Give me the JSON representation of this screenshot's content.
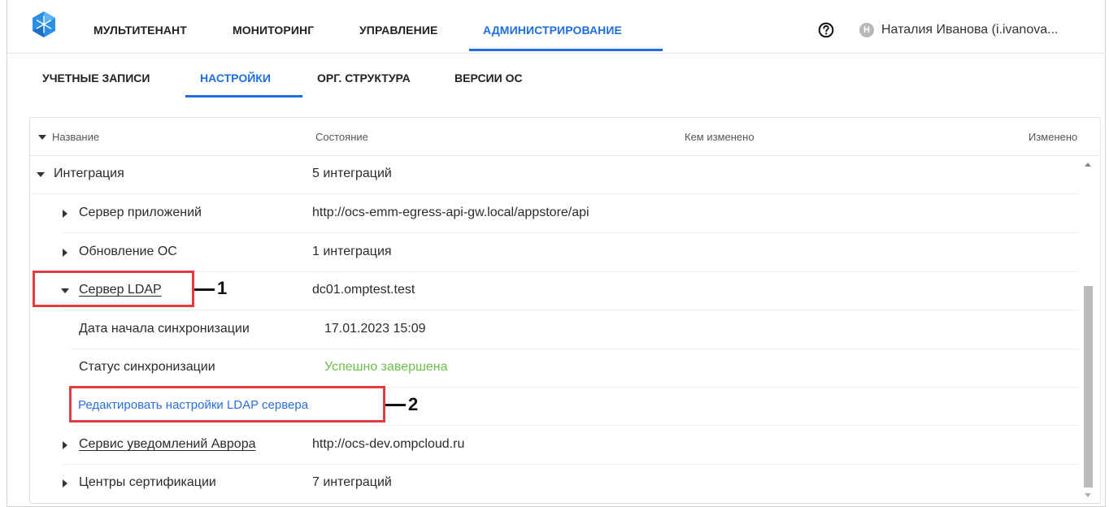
{
  "nav": {
    "items": [
      "МУЛЬТИТЕНАНТ",
      "МОНИТОРИНГ",
      "УПРАВЛЕНИЕ",
      "АДМИНИСТРИРОВАНИЕ"
    ],
    "active_index": 3,
    "help_icon": "question-circle-icon",
    "user_initial": "Н",
    "user_name": "Наталия Иванова (i.ivanova..."
  },
  "subtabs": {
    "items": [
      "УЧЕТНЫЕ ЗАПИСИ",
      "НАСТРОЙКИ",
      "ОРГ. СТРУКТУРА",
      "ВЕРСИИ ОС"
    ],
    "active_index": 1
  },
  "table": {
    "columns": [
      "Название",
      "Состояние",
      "Кем изменено",
      "Изменено"
    ],
    "rows": {
      "integration": {
        "name": "Интеграция",
        "state": "5 интеграций"
      },
      "app_server": {
        "name": "Сервер приложений",
        "state": "http://ocs-emm-egress-api-gw.local/appstore/api"
      },
      "os_update": {
        "name": "Обновление ОС",
        "state": "1 интеграция"
      },
      "ldap": {
        "name": "Сервер LDAP",
        "state": "dc01.omptest.test"
      },
      "sync_start": {
        "name": "Дата начала синхронизации",
        "state": "17.01.2023 15:09"
      },
      "sync_status": {
        "name": "Статус синхронизации",
        "state": "Успешно завершена"
      },
      "edit_ldap": {
        "name": "Редактировать настройки LDAP сервера"
      },
      "aurora_notif": {
        "name": "Сервис уведомлений Аврора",
        "state": "http://ocs-dev.ompcloud.ru"
      },
      "cert_centers": {
        "name": "Центры сертификации",
        "state": "7 интеграций"
      }
    }
  },
  "callouts": {
    "first": "1",
    "second": "2"
  },
  "colors": {
    "accent": "#1f6fe0",
    "success": "#6cbe4c",
    "highlight": "#e23c3c",
    "link": "#2a6fdb"
  }
}
